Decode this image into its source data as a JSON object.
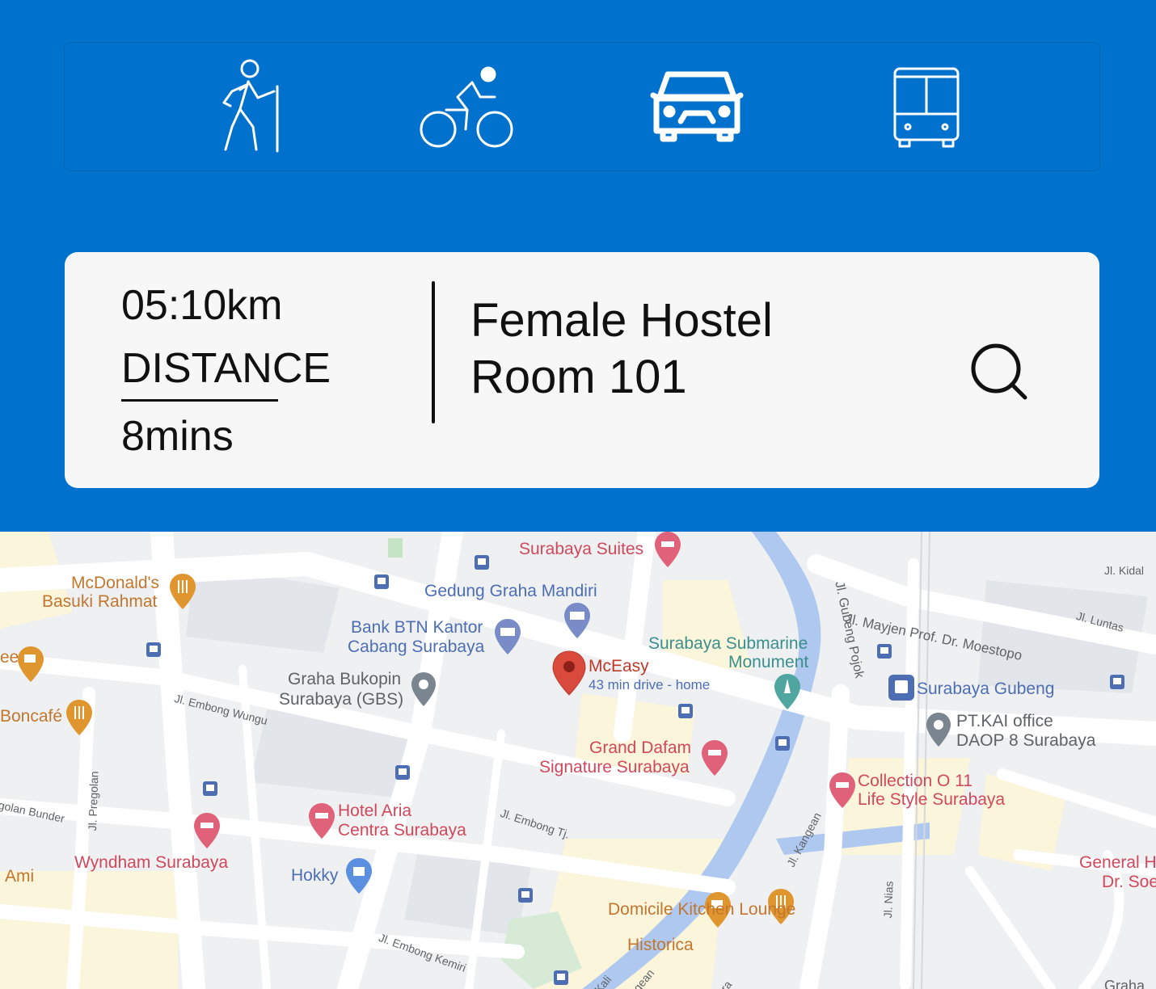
{
  "header": {
    "modes": [
      {
        "name": "walk",
        "icon": "hiker-icon",
        "selected": false
      },
      {
        "name": "bike",
        "icon": "bicycle-icon",
        "selected": false
      },
      {
        "name": "car",
        "icon": "car-icon",
        "selected": true
      },
      {
        "name": "bus",
        "icon": "bus-icon",
        "selected": false
      }
    ]
  },
  "trip": {
    "distance_value": "05:10km",
    "distance_label": "DISTANCE",
    "duration": "8mins",
    "destination_line1": "Female Hostel",
    "destination_line2": "Room 101",
    "search_icon": "search-icon"
  },
  "map": {
    "places": {
      "surabaya_suites": "Surabaya Suites",
      "mcdonalds_1": "McDonald's",
      "mcdonalds_2": "Basuki Rahmat",
      "gedung": "Gedung Graha Mandiri",
      "btn_1": "Bank BTN Kantor",
      "btn_2": "Cabang Surabaya",
      "submarine_1": "Surabaya Submarine",
      "submarine_2": "Monument",
      "mceasy": "McEasy",
      "mceasy_sub": "43 min drive - home",
      "bukopin_1": "Graha Bukopin",
      "bukopin_2": "Surabaya (GBS)",
      "boncafe": "Boncafé",
      "ee": "ee",
      "grand_1": "Grand Dafam",
      "grand_2": "Signature Surabaya",
      "gubeng": "Surabaya Gubeng",
      "ptkai_1": "PT.KAI office",
      "ptkai_2": "DAOP 8 Surabaya",
      "collection_1": "Collection O 11",
      "collection_2": "Life Style Surabaya",
      "aria_1": "Hotel Aria",
      "aria_2": "Centra Surabaya",
      "wyndham": "Wyndham Surabaya",
      "hokky": "Hokky",
      "ami": "Ami",
      "domicile": "Domicile Kitchen Lounge",
      "historica": "Historica",
      "general_1": "General H",
      "general_2": "Dr. Soe",
      "graha": "Graha"
    },
    "streets": {
      "kidal": "Jl. Kidal",
      "moestopo": "Jl. Mayjen Prof. Dr. Moestopo",
      "luntas": "Jl. Luntas",
      "gubeng_pojok": "Jl. Gubeng Pojok",
      "embong_wungu": "Jl. Embong Wungu",
      "pregolan": "Jl. Pregolan",
      "pregolan_bunder": "golan Bunder",
      "embong_tj": "Jl. Embong Tj.",
      "kangean": "Jl. Kangean",
      "nias": "Jl. Nias",
      "embong_kemiri": "Jl. Embong Kemiri",
      "kali": "Kali",
      "gean": "gean",
      "ra": "ra"
    }
  },
  "colors": {
    "header_bg": "#0072CE",
    "card_bg": "#F7F7F7",
    "poi_red": "#D0485C",
    "food_orange": "#C2762E",
    "transit_blue": "#4E6EB4",
    "river": "#AEC8F0"
  }
}
